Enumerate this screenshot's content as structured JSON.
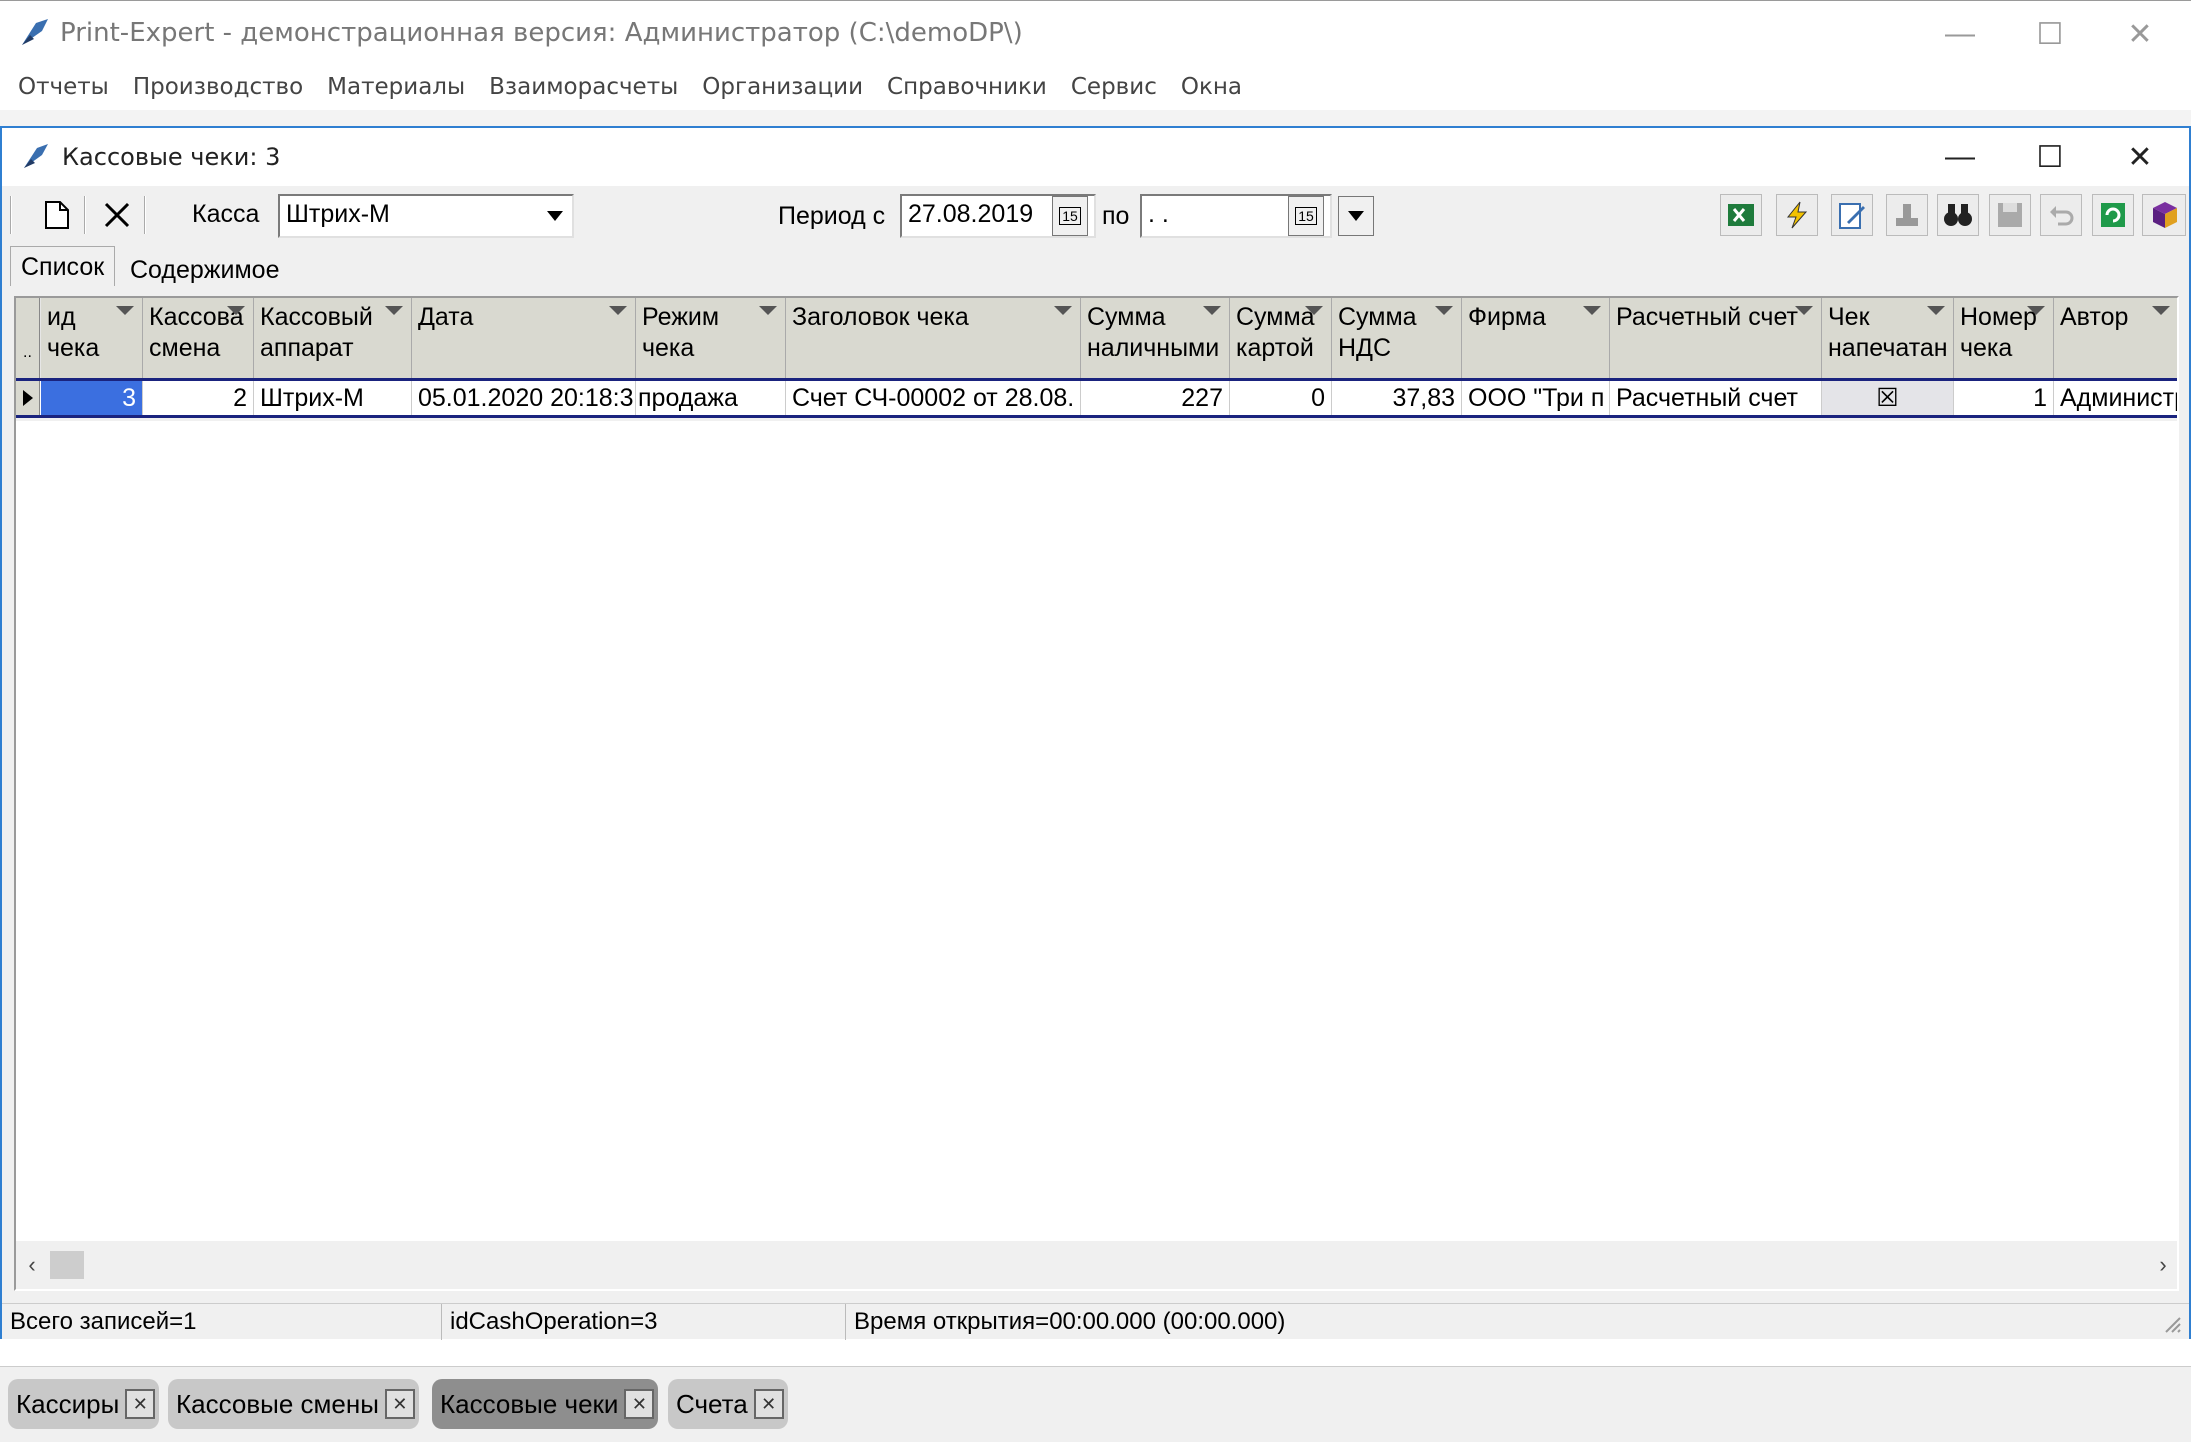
{
  "app": {
    "title": "Print-Expert - демонстрационная версия: Администратор (C:\\demoDP\\)",
    "minimize_glyph": "—",
    "maximize_glyph": "☐",
    "close_glyph": "✕"
  },
  "menu": [
    "Отчеты",
    "Производство",
    "Материалы",
    "Взаиморасчеты",
    "Организации",
    "Справочники",
    "Сервис",
    "Окна"
  ],
  "window": {
    "title": "Кассовые чеки: 3"
  },
  "toolbar": {
    "kassa_label": "Касса",
    "kassa_value": "Штрих-М",
    "period_from_label": "Период с",
    "period_from_value": "27.08.2019",
    "period_to_label": "по",
    "period_to_value": " .  .",
    "calendar_glyph": "15"
  },
  "tabs": [
    "Список",
    "Содержимое"
  ],
  "grid": {
    "indicator_label": "..",
    "columns": [
      "ид\nчека",
      "Кассова\nсмена",
      "Кассовый\nаппарат",
      "Дата",
      "Режим\nчека",
      "Заголовок чека",
      "Сумма\nналичными",
      "Сумма\nкартой",
      "Сумма\nНДС",
      "Фирма",
      "Расчетный счет",
      "Чек\nнапечатан",
      "Номер\nчека",
      "Автор"
    ],
    "rows": [
      {
        "id": "3",
        "shift": "2",
        "device": "Штрих-М",
        "date": "05.01.2020 20:18:3",
        "mode": "продажа",
        "header": "Счет СЧ-00002 от 28.08.",
        "cash": "227",
        "card": "0",
        "vat": "37,83",
        "firm": "ООО \"Три п",
        "account": "Расчетный счет",
        "printed_glyph": "☒",
        "number": "1",
        "author": "Администратор"
      }
    ]
  },
  "status": {
    "records": "Всего записей=1",
    "id_op": "idCashOperation=3",
    "open_time": "Время открытия=00:00.000 (00:00.000)"
  },
  "window_tabs": [
    "Кассиры",
    "Кассовые смены",
    "Кассовые чеки",
    "Счета"
  ],
  "active_window_tab": "Кассовые чеки"
}
